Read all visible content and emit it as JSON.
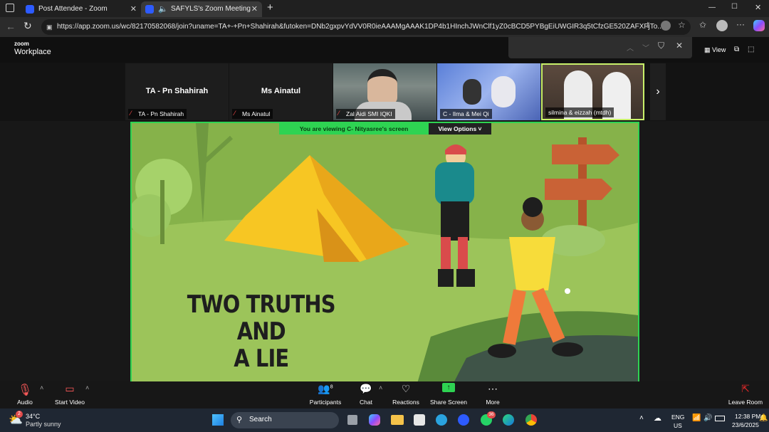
{
  "browser": {
    "tabs": [
      {
        "title": "Post Attendee - Zoom",
        "close": "✕"
      },
      {
        "title": "SAFYLS's Zoom Meeting",
        "close": "✕"
      }
    ],
    "new_tab": "+",
    "url": "https://app.zoom.us/wc/82170582068/join?uname=TA+-+Pn+Shahirah&futoken=DNb2gxpvYdVV0R0ieAAAMgAAAK1DP4b1HInchJWnClf1yZ0cBCD5PYBgEiUWGIR3q5tCfzGE520ZAFXFjTo...",
    "window_controls": [
      "—",
      "☐",
      "✕"
    ]
  },
  "zoom": {
    "logo_top": "zoom",
    "logo_bottom": "Workplace",
    "view_label": "View",
    "participants_thumbs": [
      {
        "big": "TA - Pn Shahirah",
        "label": "TA - Pn Shahirah"
      },
      {
        "big": "Ms Ainatul",
        "label": "Ms Ainatul"
      },
      {
        "big": "",
        "label": "Zal Aidi SMI IQKI"
      },
      {
        "big": "",
        "label": "C - Ilma & Mei Qi"
      },
      {
        "big": "",
        "label": "silmina & eizzah (mtdh)"
      }
    ],
    "viewing_banner": "You are viewing  C- Nityasree's screen",
    "view_options": "View Options",
    "slide_title_line1": "TWO TRUTHS AND",
    "slide_title_line2": "A LIE",
    "toolbar": {
      "audio": "Audio",
      "start_video": "Start Video",
      "participants": "Participants",
      "participants_count": "8",
      "chat": "Chat",
      "reactions": "Reactions",
      "share_screen": "Share Screen",
      "more": "More",
      "leave": "Leave Room"
    }
  },
  "taskbar": {
    "weather_temp": "34°C",
    "weather_desc": "Partly sunny",
    "weather_badge": "2",
    "search_placeholder": "Search",
    "lang_1": "ENG",
    "lang_2": "US",
    "time": "12:38 PM",
    "date": "23/6/2025",
    "whatsapp_badge": "36"
  },
  "colors": {
    "accent_green": "#2ed352",
    "slide_bg": "#82b04a",
    "leave_red": "#e02828"
  }
}
